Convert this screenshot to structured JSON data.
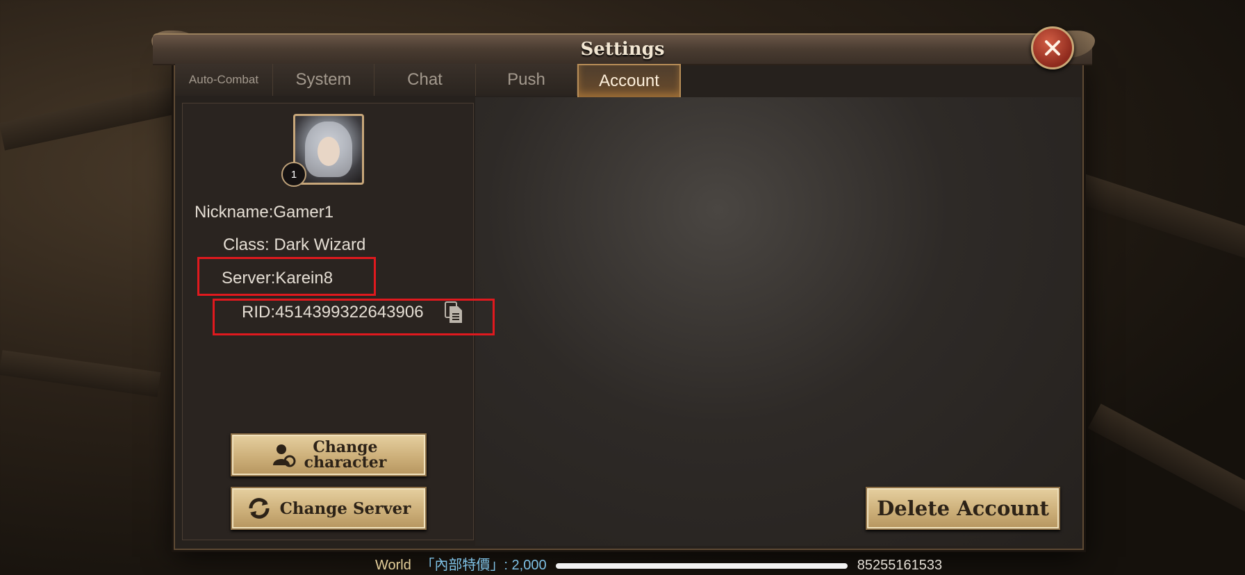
{
  "window": {
    "title": "Settings"
  },
  "tabs": [
    {
      "label": "Auto-Combat",
      "active": false
    },
    {
      "label": "System",
      "active": false
    },
    {
      "label": "Chat",
      "active": false
    },
    {
      "label": "Push",
      "active": false
    },
    {
      "label": "Account",
      "active": true
    }
  ],
  "profile": {
    "level": "1",
    "nickname": "Nickname:Gamer1",
    "class": "Class: Dark Wizard",
    "server": "Server:Karein8",
    "rid": "RID:4514399322643906"
  },
  "buttons": {
    "change_character_line1": "Change",
    "change_character_line2": "character",
    "change_server": "Change Server",
    "delete_account": "Delete Account"
  },
  "ticker": {
    "channel": "World",
    "text_start": "「內部特價」: 2,000",
    "text_end": "85255161533"
  },
  "colors": {
    "highlight": "#e0191e",
    "active_tab_border": "#b78d57",
    "button_gold": "#cdb07a"
  },
  "icons": [
    "close-icon",
    "copy-icon",
    "change-character-icon",
    "change-server-icon"
  ]
}
